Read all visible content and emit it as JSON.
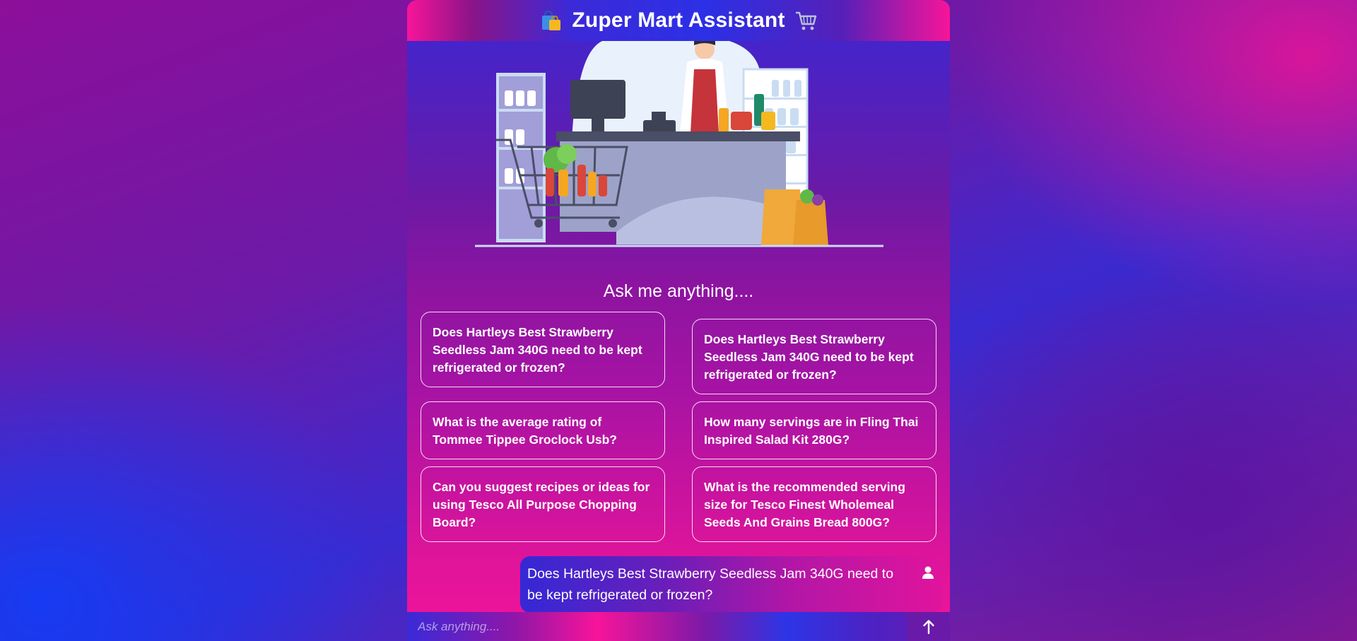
{
  "header": {
    "title": "Zuper Mart Assistant",
    "left_icon": "shopping-bags-icon",
    "right_icon": "shopping-cart-icon"
  },
  "hero": {
    "image": "grocery-store-cashier-illustration"
  },
  "prompt_title": "Ask me anything....",
  "suggestions": [
    {
      "text": "Does Hartleys Best Strawberry Seedless Jam 340G need to be kept refrigerated or frozen?"
    },
    {
      "text": "Does Hartleys Best Strawberry Seedless Jam 340G need to be kept refrigerated or frozen?"
    },
    {
      "text": "What is the average rating of Tommee Tippee Groclock Usb?"
    },
    {
      "text": "How many servings are in Fling Thai Inspired Salad Kit 280G?"
    },
    {
      "text": "Can you suggest recipes or ideas for using Tesco All Purpose Chopping Board?"
    },
    {
      "text": "What is the recommended serving size for Tesco Finest Wholemeal Seeds And Grains Bread 800G?"
    }
  ],
  "messages": [
    {
      "role": "user",
      "text": "Does Hartleys Best Strawberry Seedless Jam 340G need to be kept refrigerated or frozen?",
      "icon": "user-icon"
    }
  ],
  "input": {
    "placeholder": "Ask anything....",
    "value": "",
    "send_icon": "arrow-up-icon"
  },
  "colors": {
    "accent_pink": "#f7149a",
    "accent_blue": "#2c30e6",
    "text": "#ffffff"
  }
}
